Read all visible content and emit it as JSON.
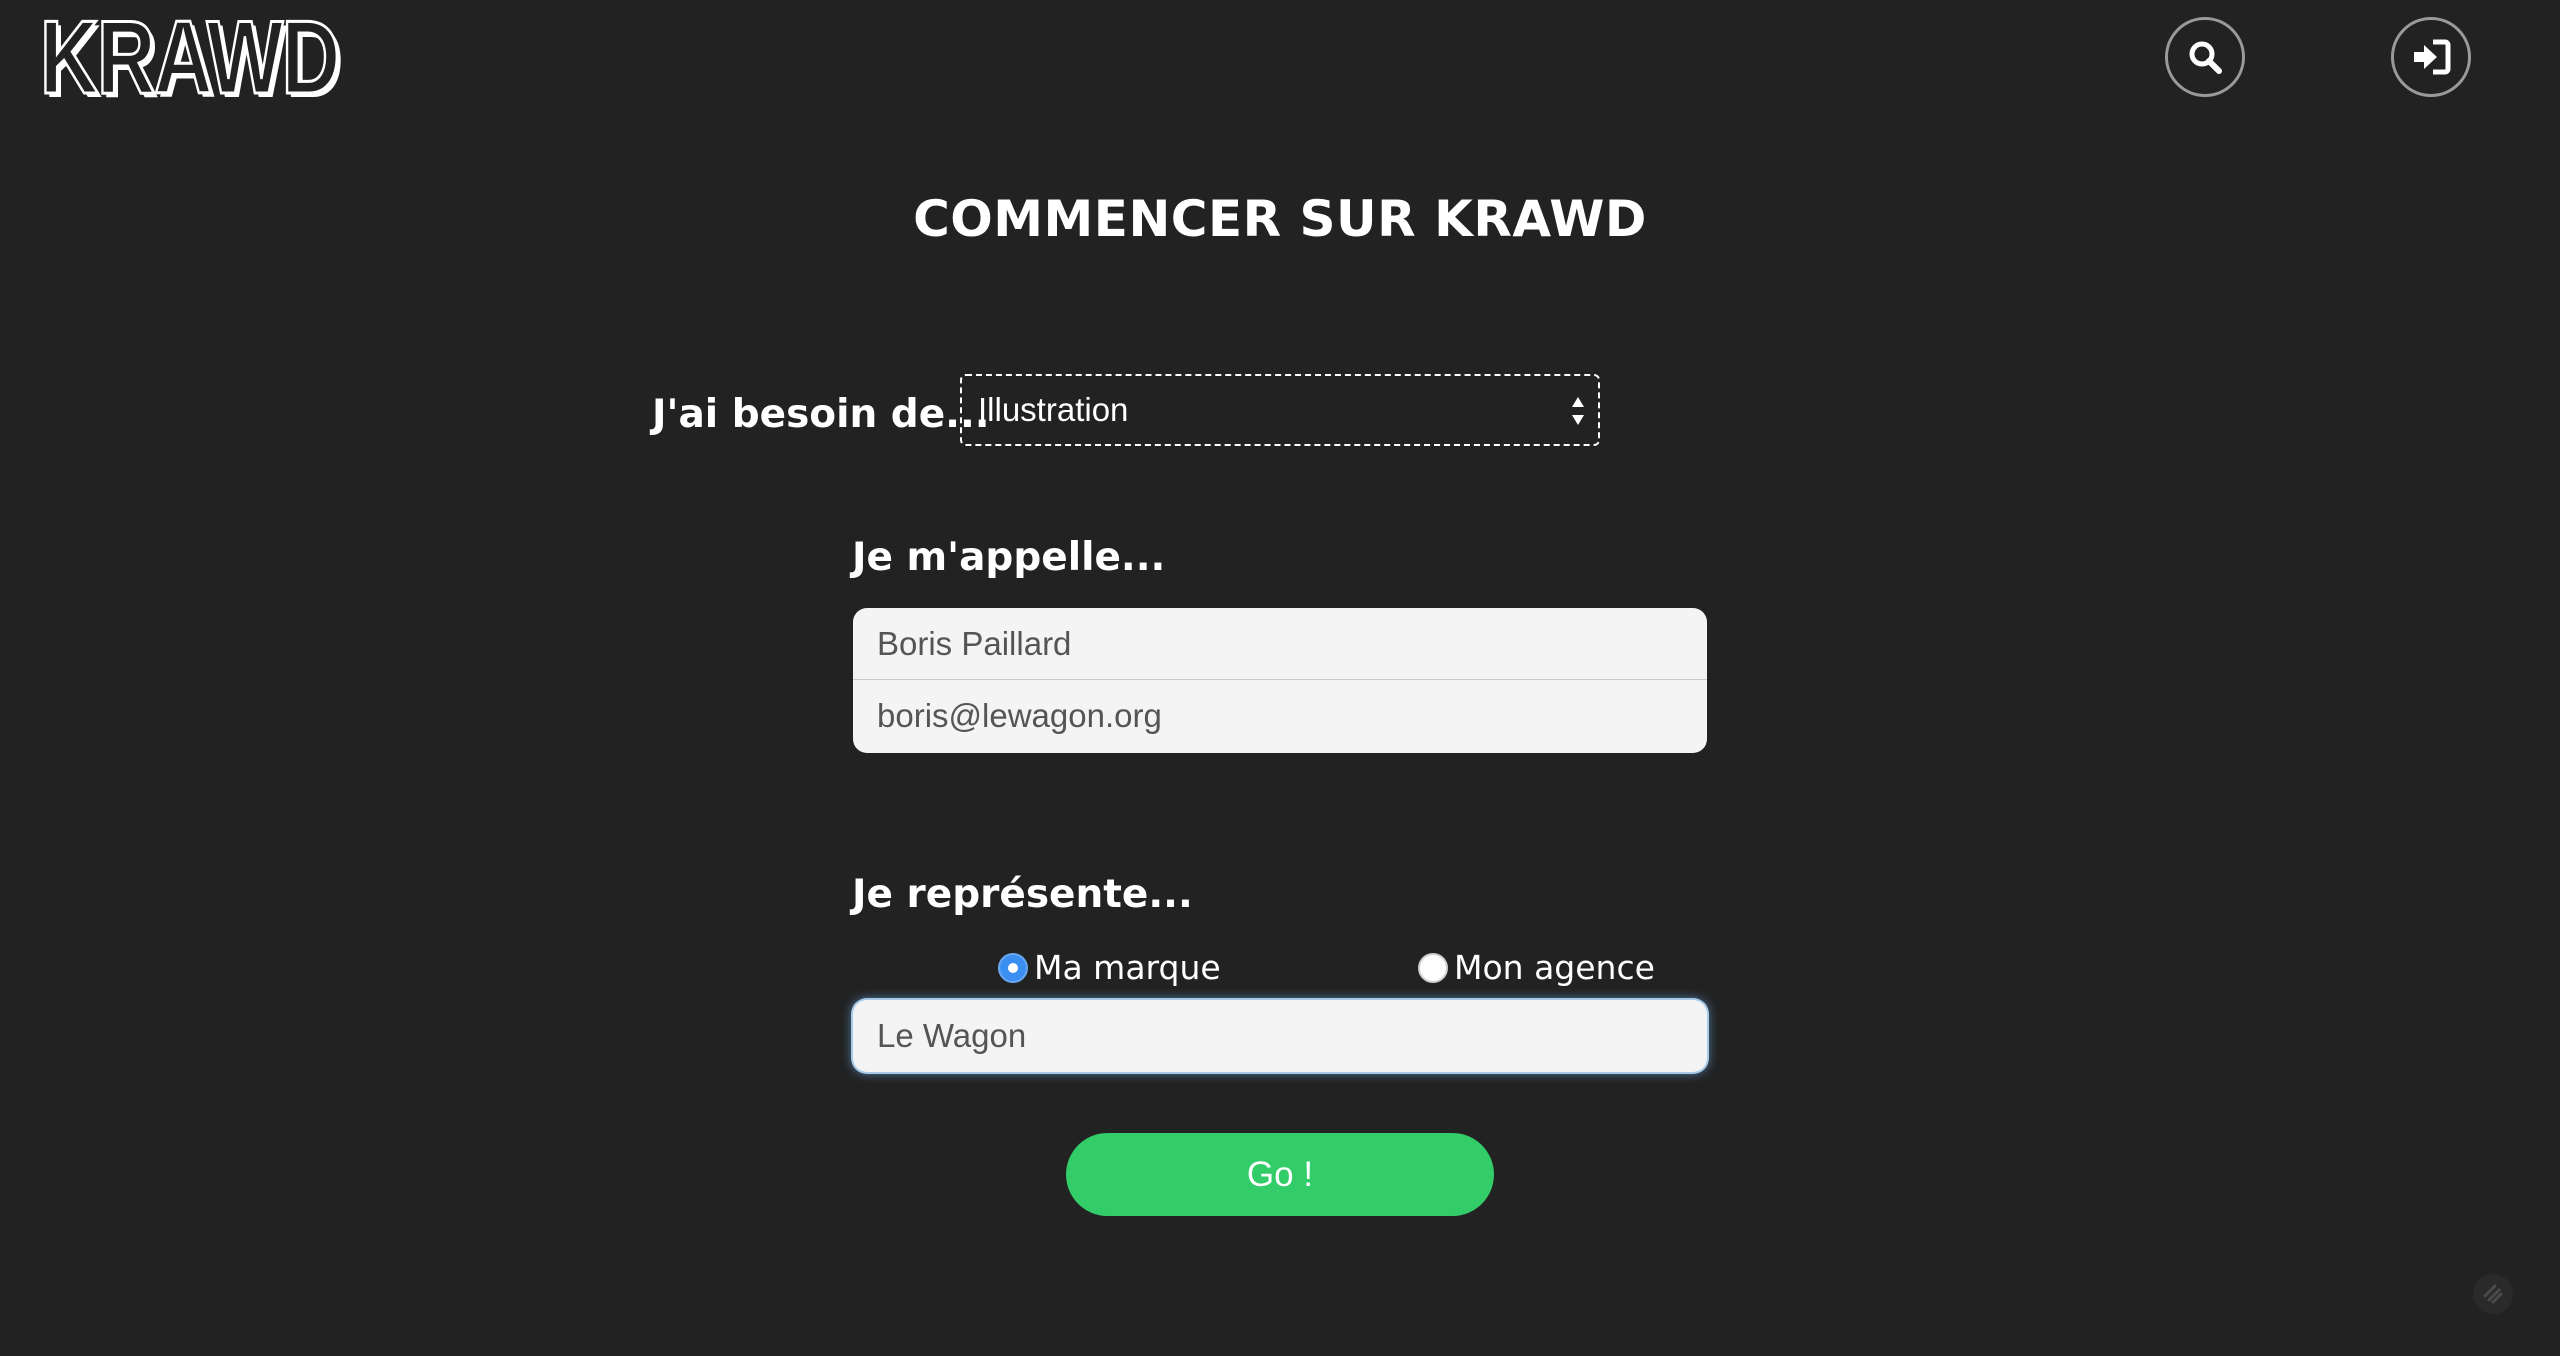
{
  "header": {
    "logo_text": "KRAWD",
    "search_icon": "search-icon",
    "login_icon": "sign-in-icon"
  },
  "title": "COMMENCER SUR KRAWD",
  "need": {
    "label": "J'ai besoin de...",
    "selected": "Illustration"
  },
  "identity": {
    "label": "Je m'appelle...",
    "name_value": "Boris Paillard",
    "email_value": "boris@lewagon.org"
  },
  "represent": {
    "label": "Je représente...",
    "options": [
      {
        "label": "Ma marque",
        "checked": true
      },
      {
        "label": "Mon agence",
        "checked": false
      }
    ],
    "company_value": "Le Wagon"
  },
  "submit_label": "Go !",
  "colors": {
    "background": "#222222",
    "accent_green": "#32cd68",
    "radio_blue": "#3b8ff0"
  }
}
